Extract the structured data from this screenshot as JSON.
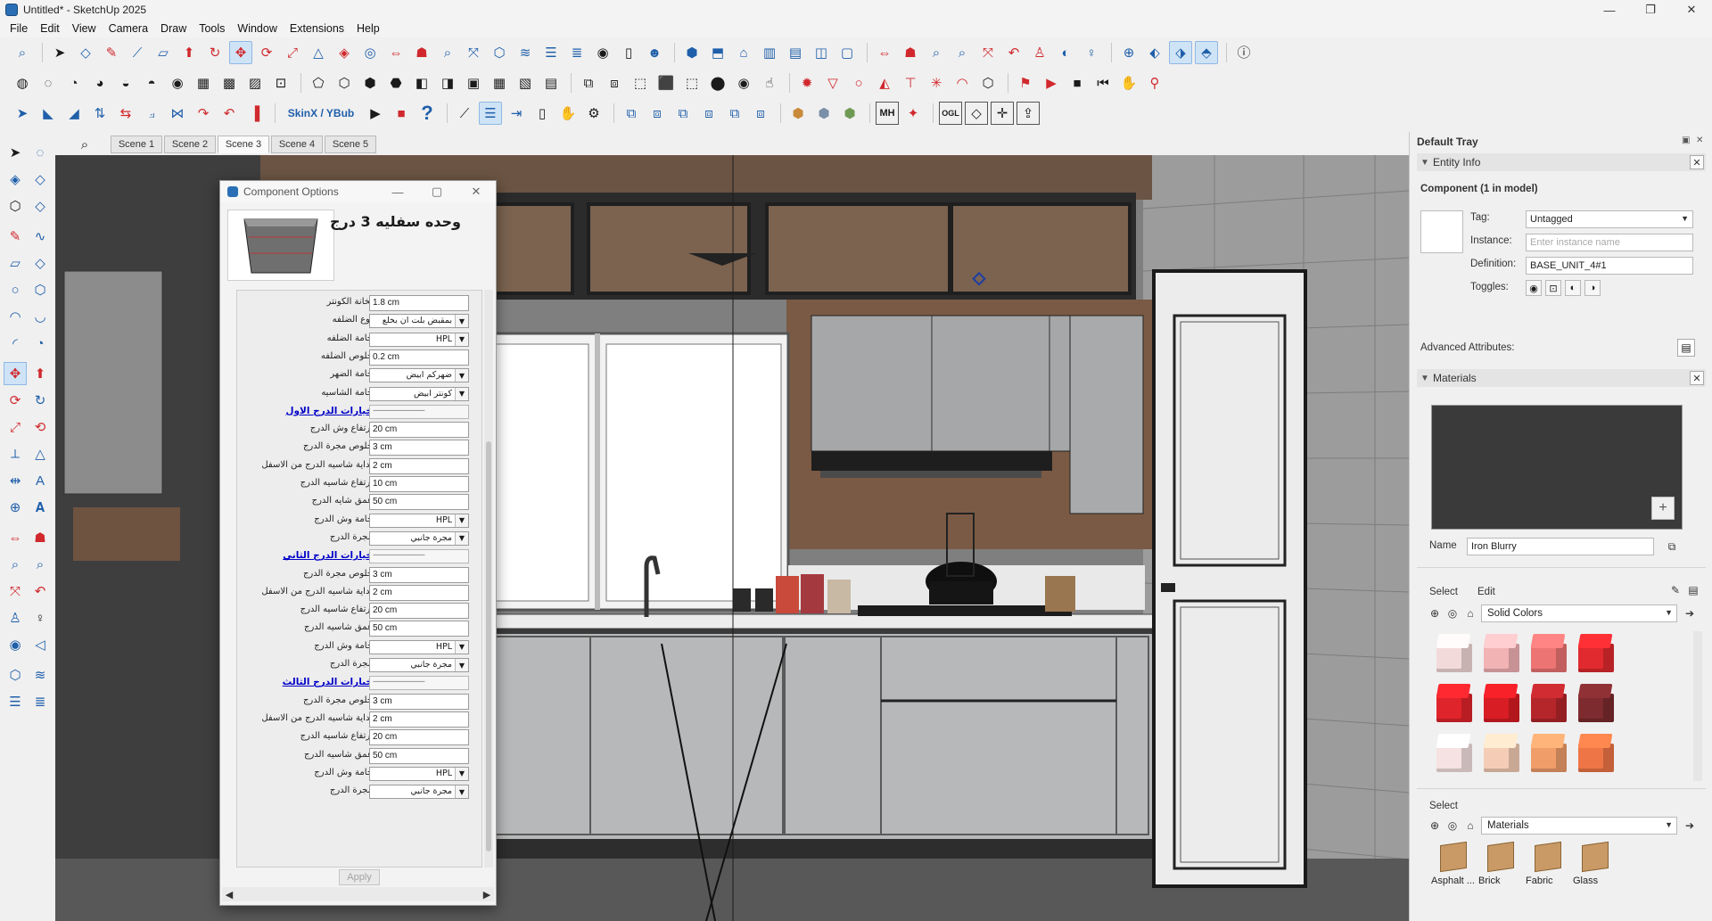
{
  "window": {
    "title": "Untitled* - SketchUp 2025",
    "minimize": "—",
    "maximize": "❐",
    "close": "✕"
  },
  "menu": [
    "File",
    "Edit",
    "View",
    "Camera",
    "Draw",
    "Tools",
    "Window",
    "Extensions",
    "Help"
  ],
  "toolbar": {
    "skinx_label": "SkinX / YBub",
    "mh_label": "MH",
    "ogl_label": "OGL"
  },
  "scenes": {
    "tabs": [
      "Scene 1",
      "Scene 2",
      "Scene 3",
      "Scene 4",
      "Scene 5"
    ],
    "active": "Scene 3"
  },
  "component_options": {
    "title": "Component Options",
    "component_name": "وحده سفليه 3 درج",
    "apply_label": "Apply",
    "rows": [
      {
        "label": "تخانة الكونتر",
        "type": "input",
        "value": "1.8 cm"
      },
      {
        "label": "نوع الضلفه",
        "type": "select",
        "value": "بمقبض بلت ان بخلع"
      },
      {
        "label": "خامة الضلفه",
        "type": "select",
        "value": "HPL"
      },
      {
        "label": "خلوص الضلفه",
        "type": "input",
        "value": "0.2 cm"
      },
      {
        "label": "خامة الضهر",
        "type": "select",
        "value": "ضهركم ابيض"
      },
      {
        "label": "خامة الشاسيه",
        "type": "select",
        "value": "كونتر ابيض"
      },
      {
        "label": "خيارات الدرج الاول",
        "type": "section",
        "value": "-----------------------------"
      },
      {
        "label": "ارتفاع وش الدرج",
        "type": "input",
        "value": "20 cm"
      },
      {
        "label": "خلوص مجرة الدرج",
        "type": "input",
        "value": "3 cm"
      },
      {
        "label": "بداية شاسيه الدرج من الاسفل",
        "type": "input",
        "value": "2 cm"
      },
      {
        "label": "ارتفاع شاسيه الدرج",
        "type": "input",
        "value": "10 cm"
      },
      {
        "label": "عمق شايه الدرج",
        "type": "input",
        "value": "50 cm"
      },
      {
        "label": "خامة وش الدرج",
        "type": "select",
        "value": "HPL"
      },
      {
        "label": "مجرة الدرج",
        "type": "select",
        "value": "مجرة جانبي"
      },
      {
        "label": "خيارات الدرج الثاني",
        "type": "section",
        "value": "-----------------------------"
      },
      {
        "label": "خلوص مجرة الدرج",
        "type": "input",
        "value": "3 cm"
      },
      {
        "label": "بداية شاسيه الدرج من الاسفل",
        "type": "input",
        "value": "2 cm"
      },
      {
        "label": "ارتفاع شاسيه الدرج",
        "type": "input",
        "value": "20 cm"
      },
      {
        "label": "عمق شاسيه الدرج",
        "type": "input",
        "value": "50 cm"
      },
      {
        "label": "خامة وش الدرج",
        "type": "select",
        "value": "HPL"
      },
      {
        "label": "مجرة الدرج",
        "type": "select",
        "value": "مجرة جانبي"
      },
      {
        "label": "خيارات الدرج الثالث",
        "type": "section",
        "value": "-----------------------------"
      },
      {
        "label": "خلوص مجرة الدرج",
        "type": "input",
        "value": "3 cm"
      },
      {
        "label": "بداية شاسيه الدرج من الاسفل",
        "type": "input",
        "value": "2 cm"
      },
      {
        "label": "ارتفاع شاسيه الدرج",
        "type": "input",
        "value": "20 cm"
      },
      {
        "label": "عمق شاسيه الدرج",
        "type": "input",
        "value": "50 cm"
      },
      {
        "label": "خامة وش الدرج",
        "type": "select",
        "value": "HPL"
      },
      {
        "label": "مجرة الدرج",
        "type": "select",
        "value": "مجرة جانبي"
      }
    ]
  },
  "tray": {
    "title": "Default Tray",
    "entity_info": {
      "header": "Entity Info",
      "summary": "Component (1 in model)",
      "tag_label": "Tag:",
      "tag_value": "Untagged",
      "instance_label": "Instance:",
      "instance_placeholder": "Enter instance name",
      "definition_label": "Definition:",
      "definition_value": "BASE_UNIT_4#1",
      "toggles_label": "Toggles:",
      "advanced_label": "Advanced Attributes:"
    },
    "materials": {
      "header": "Materials",
      "name_label": "Name",
      "name_value": "Iron Blurry",
      "tab_select": "Select",
      "tab_edit": "Edit",
      "library": "Solid Colors",
      "swatch_colors": [
        [
          "#f3dada",
          "#f2b3b5",
          "#ec7473",
          "#e02a2f"
        ],
        [
          "#e0242b",
          "#d81d24",
          "#b5262b",
          "#7d2b2e"
        ],
        [
          "#f6e2e2",
          "#f5cdb6",
          "#f09d6a",
          "#ee7646"
        ]
      ],
      "select2_label": "Select",
      "library2": "Materials",
      "folders": [
        "Asphalt ...",
        "Brick",
        "Fabric",
        "Glass"
      ]
    }
  }
}
